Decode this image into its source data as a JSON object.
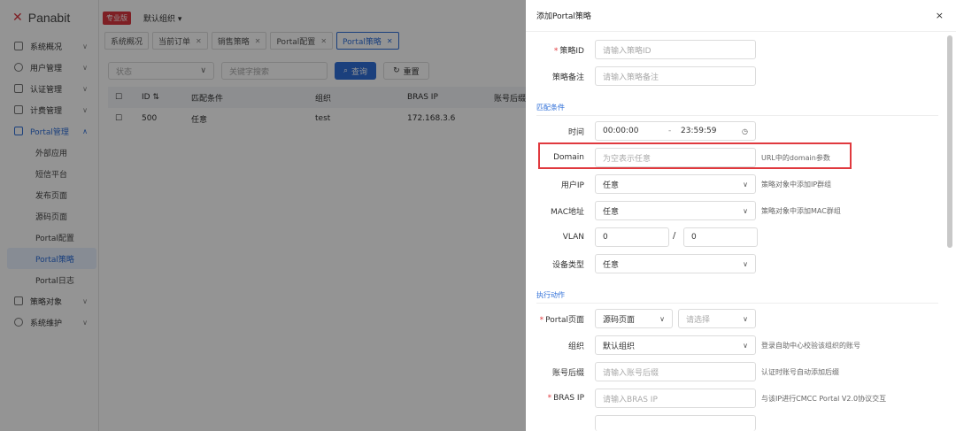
{
  "app": {
    "brand": "Panabit",
    "edition_badge": "专业版",
    "org_selector": "默认组织"
  },
  "sidebar": {
    "items": [
      {
        "label": "系统概况"
      },
      {
        "label": "用户管理"
      },
      {
        "label": "认证管理"
      },
      {
        "label": "计费管理"
      },
      {
        "label": "Portal管理"
      }
    ],
    "portal_sub": [
      {
        "label": "外部应用"
      },
      {
        "label": "短信平台"
      },
      {
        "label": "发布页面"
      },
      {
        "label": "源码页面"
      },
      {
        "label": "Portal配置"
      },
      {
        "label": "Portal策略"
      },
      {
        "label": "Portal日志"
      }
    ],
    "tail_items": [
      {
        "label": "策略对象"
      },
      {
        "label": "系统维护"
      }
    ]
  },
  "tabs": [
    {
      "label": "系统概况"
    },
    {
      "label": "当前订单"
    },
    {
      "label": "销售策略"
    },
    {
      "label": "Portal配置"
    },
    {
      "label": "Portal策略"
    }
  ],
  "filters": {
    "status_placeholder": "状态",
    "keyword_placeholder": "关键字搜索",
    "query_label": "查询",
    "reset_label": "重置"
  },
  "table": {
    "columns": [
      "ID",
      "匹配条件",
      "组织",
      "BRAS IP",
      "账号后缀"
    ],
    "rows": [
      {
        "id": "500",
        "cond": "任意",
        "org": "test",
        "bras": "172.168.3.6"
      }
    ]
  },
  "drawer": {
    "title": "添加Portal策略",
    "close": "×",
    "policy_id_label": "策略ID",
    "policy_id_placeholder": "请输入策略ID",
    "remark_label": "策略备注",
    "remark_placeholder": "请输入策略备注",
    "match_section": "匹配条件",
    "time_label": "时间",
    "time_start": "00:00:00",
    "time_sep": "-",
    "time_end": "23:59:59",
    "domain_label": "Domain",
    "domain_placeholder": "为空表示任意",
    "domain_hint": "URL中的domain参数",
    "userip_label": "用户IP",
    "userip_value": "任意",
    "userip_hint": "策略对象中添加IP群组",
    "mac_label": "MAC地址",
    "mac_value": "任意",
    "mac_hint": "策略对象中添加MAC群组",
    "vlan_label": "VLAN",
    "vlan_from": "0",
    "vlan_sep": "/",
    "vlan_to": "0",
    "device_label": "设备类型",
    "device_value": "任意",
    "action_section": "执行动作",
    "portal_page_label": "Portal页面",
    "portal_page_value": "源码页面",
    "portal_page_second_placeholder": "请选择",
    "org_label": "组织",
    "org_value": "默认组织",
    "org_hint": "登录自助中心校验该组织的账号",
    "suffix_label": "账号后缀",
    "suffix_placeholder": "请输入账号后缀",
    "suffix_hint": "认证时账号自动添加后缀",
    "bras_label": "BRAS IP",
    "bras_placeholder": "请输入BRAS IP",
    "bras_hint": "与该IP进行CMCC Portal V2.0协议交互"
  }
}
